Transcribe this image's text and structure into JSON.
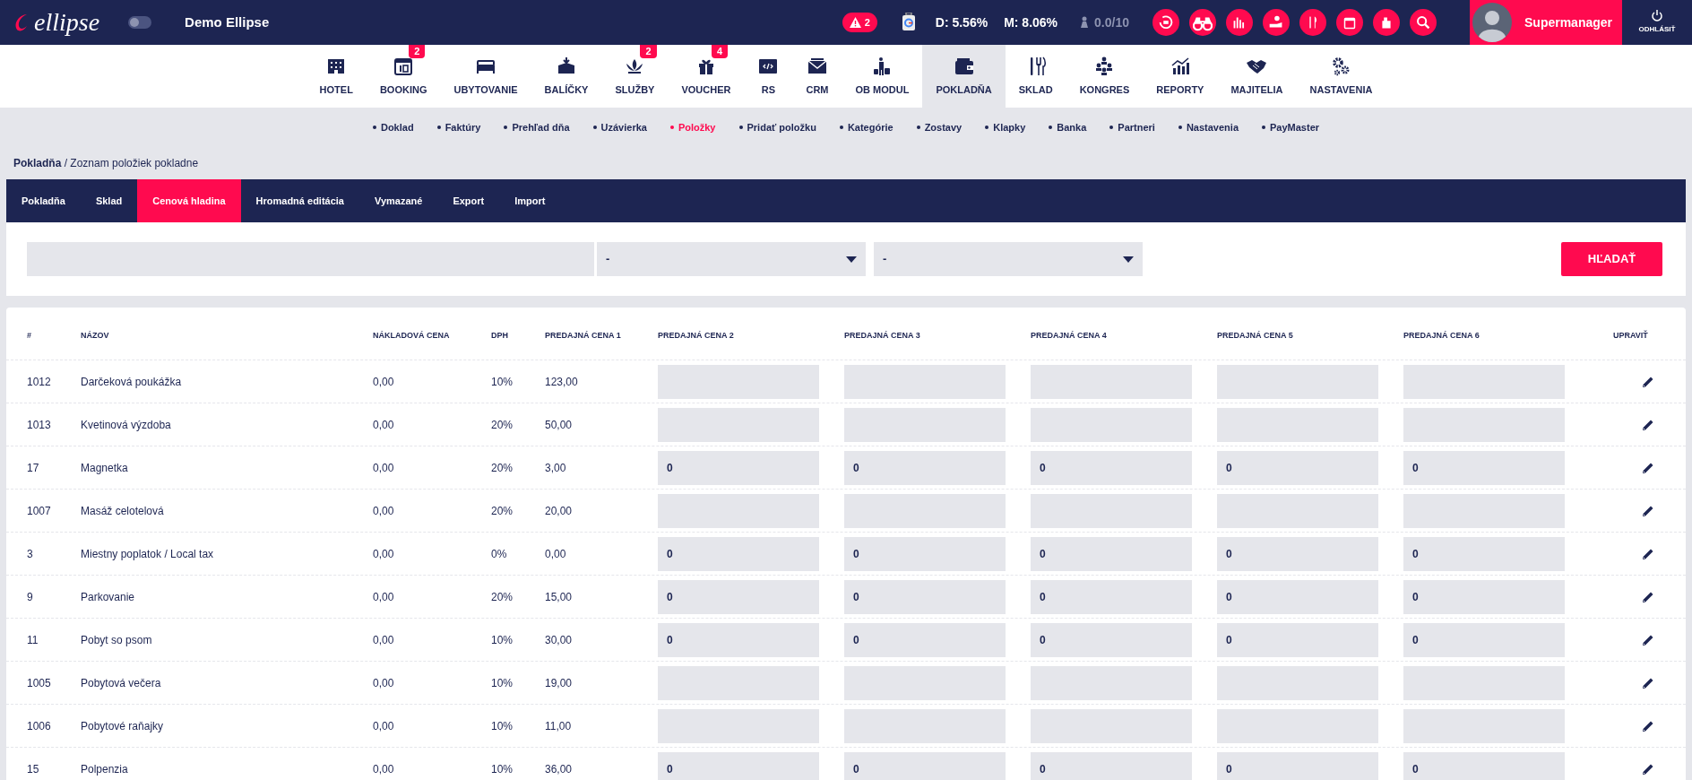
{
  "topbar": {
    "brand": "ellipse",
    "toggle": {
      "on": false
    },
    "hotel": "Demo Ellipse",
    "alerts": "2",
    "d": "D: 5.56%",
    "m": "M: 8.06%",
    "rating": "0.0/10",
    "user": "Supermanager",
    "logout": "ODHLÁSIŤ"
  },
  "modules": [
    {
      "label": "HOTEL",
      "selected": false
    },
    {
      "label": "BOOKING",
      "badge": "2",
      "selected": false
    },
    {
      "label": "UBYTOVANIE",
      "selected": false
    },
    {
      "label": "BALÍČKY",
      "selected": false
    },
    {
      "label": "SLUŽBY",
      "badge": "2",
      "selected": false
    },
    {
      "label": "VOUCHER",
      "badge": "4",
      "selected": false
    },
    {
      "label": "RS",
      "selected": false
    },
    {
      "label": "CRM",
      "selected": false
    },
    {
      "label": "OB MODUL",
      "selected": false
    },
    {
      "label": "POKLADŇA",
      "selected": true
    },
    {
      "label": "SKLAD",
      "selected": false
    },
    {
      "label": "KONGRES",
      "selected": false
    },
    {
      "label": "REPORTY",
      "selected": false
    },
    {
      "label": "MAJITELIA",
      "selected": false
    },
    {
      "label": "NASTAVENIA",
      "selected": false
    }
  ],
  "subnav": [
    {
      "label": "Doklad",
      "selected": false
    },
    {
      "label": "Faktúry",
      "selected": false
    },
    {
      "label": "Prehľad dňa",
      "selected": false
    },
    {
      "label": "Uzávierka",
      "selected": false
    },
    {
      "label": "Položky",
      "selected": true
    },
    {
      "label": "Pridať položku",
      "selected": false
    },
    {
      "label": "Kategórie",
      "selected": false
    },
    {
      "label": "Zostavy",
      "selected": false
    },
    {
      "label": "Klapky",
      "selected": false
    },
    {
      "label": "Banka",
      "selected": false
    },
    {
      "label": "Partneri",
      "selected": false
    },
    {
      "label": "Nastavenia",
      "selected": false
    },
    {
      "label": "PayMaster",
      "selected": false
    }
  ],
  "breadcrumb": {
    "section": "Pokladňa",
    "page": " / Zoznam položiek pokladne"
  },
  "tabs": [
    {
      "label": "Pokladňa",
      "selected": false
    },
    {
      "label": "Sklad",
      "selected": false
    },
    {
      "label": "Cenová hladina",
      "selected": true
    },
    {
      "label": "Hromadná editácia",
      "selected": false
    },
    {
      "label": "Vymazané",
      "selected": false
    },
    {
      "label": "Export",
      "selected": false
    },
    {
      "label": "Import",
      "selected": false
    }
  ],
  "filter": {
    "select_1": "-",
    "select_2": "-",
    "search_button": "HĽADAŤ"
  },
  "table": {
    "columns": [
      "#",
      "NÁZOV",
      "NÁKLADOVÁ CENA",
      "DPH",
      "PREDAJNÁ CENA 1",
      "PREDAJNÁ CENA 2",
      "PREDAJNÁ CENA 3",
      "PREDAJNÁ CENA 4",
      "PREDAJNÁ CENA 5",
      "PREDAJNÁ CENA 6",
      "UPRAVIŤ"
    ],
    "rows": [
      {
        "id": "1012",
        "name": "Darčeková poukážka",
        "cost": "0,00",
        "vat": "10%",
        "price_1": "123,00"
      },
      {
        "id": "1013",
        "name": "Kvetinová výzdoba",
        "cost": "0,00",
        "vat": "20%",
        "price_1": "50,00"
      },
      {
        "id": "17",
        "name": "Magnetka",
        "cost": "0,00",
        "vat": "20%",
        "price_1": "3,00",
        "prices": [
          "0",
          "0",
          "0",
          "0",
          "0"
        ]
      },
      {
        "id": "1007",
        "name": "Masáž celotelová",
        "cost": "0,00",
        "vat": "20%",
        "price_1": "20,00"
      },
      {
        "id": "3",
        "name": "Miestny poplatok / Local tax",
        "cost": "0,00",
        "vat": "0%",
        "price_1": "0,00",
        "prices": [
          "0",
          "0",
          "0",
          "0",
          "0"
        ]
      },
      {
        "id": "9",
        "name": "Parkovanie",
        "cost": "0,00",
        "vat": "20%",
        "price_1": "15,00",
        "prices": [
          "0",
          "0",
          "0",
          "0",
          "0"
        ]
      },
      {
        "id": "11",
        "name": "Pobyt so psom",
        "cost": "0,00",
        "vat": "10%",
        "price_1": "30,00",
        "prices": [
          "0",
          "0",
          "0",
          "0",
          "0"
        ]
      },
      {
        "id": "1005",
        "name": "Pobytová večera",
        "cost": "0,00",
        "vat": "10%",
        "price_1": "19,00"
      },
      {
        "id": "1006",
        "name": "Pobytové raňajky",
        "cost": "0,00",
        "vat": "10%",
        "price_1": "11,00"
      },
      {
        "id": "15",
        "name": "Polpenzia",
        "cost": "0,00",
        "vat": "10%",
        "price_1": "36,00",
        "prices": [
          "0",
          "0",
          "0",
          "0",
          "0"
        ]
      }
    ]
  }
}
